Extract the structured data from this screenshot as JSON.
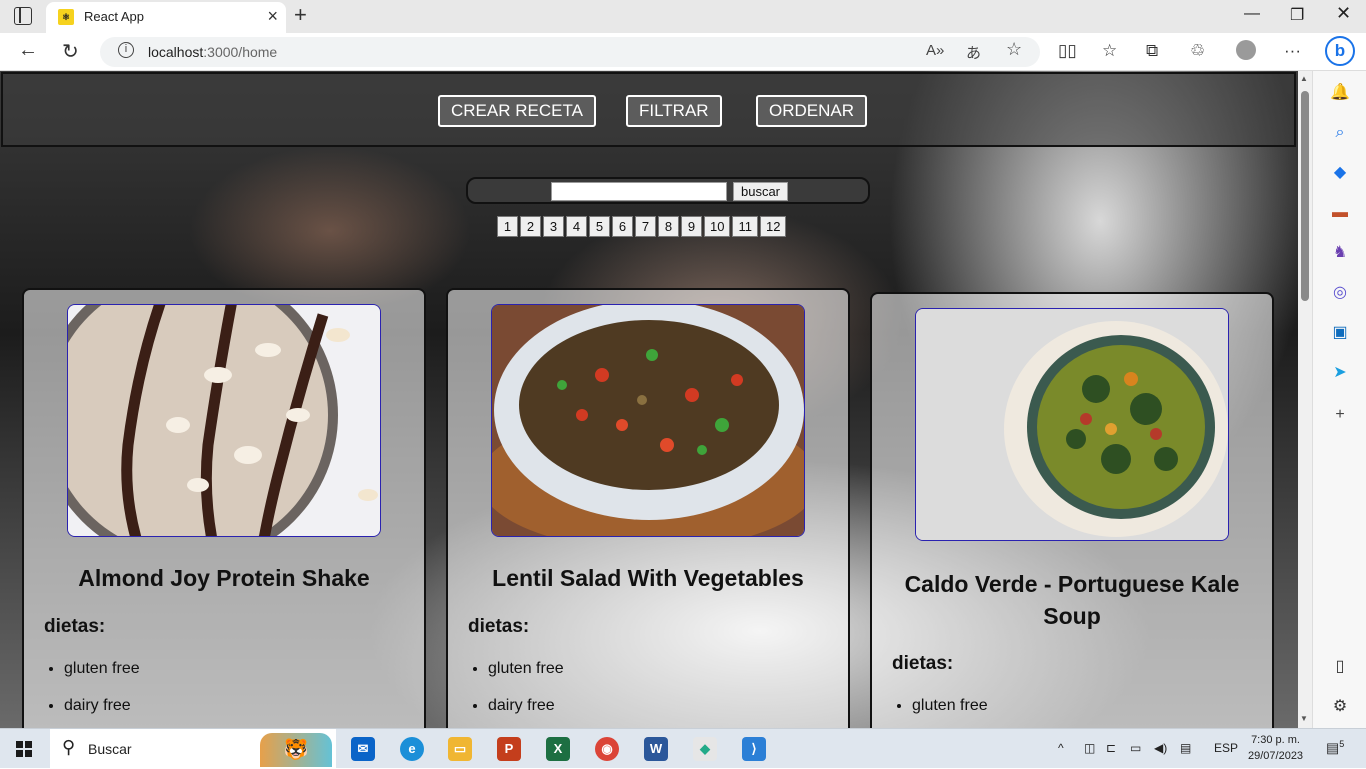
{
  "browser": {
    "tab_title": "React App",
    "favicon_text": "⚛",
    "url_host": "localhost",
    "url_path": ":3000/home"
  },
  "navbar": {
    "buttons": [
      "CREAR RECETA",
      "FILTRAR",
      "ORDENAR"
    ]
  },
  "search": {
    "value": "",
    "button_label": "buscar"
  },
  "pagination": [
    "1",
    "2",
    "3",
    "4",
    "5",
    "6",
    "7",
    "8",
    "9",
    "10",
    "11",
    "12"
  ],
  "cards": [
    {
      "title": "Almond Joy Protein Shake",
      "dietas_label": "dietas:",
      "diets": [
        "gluten free",
        "dairy free"
      ]
    },
    {
      "title": "Lentil Salad With Vegetables",
      "dietas_label": "dietas:",
      "diets": [
        "gluten free",
        "dairy free"
      ]
    },
    {
      "title": "Caldo Verde - Portuguese Kale Soup",
      "dietas_label": "dietas:",
      "diets": [
        "gluten free"
      ]
    }
  ],
  "taskbar": {
    "search_placeholder": "Buscar",
    "language": "ESP",
    "time": "7:30 p. m.",
    "date": "29/07/2023",
    "notifications": "5"
  },
  "colors": {
    "card_image_border": "#2a22b0",
    "navbar_button_bg": "#5c5c5c"
  }
}
